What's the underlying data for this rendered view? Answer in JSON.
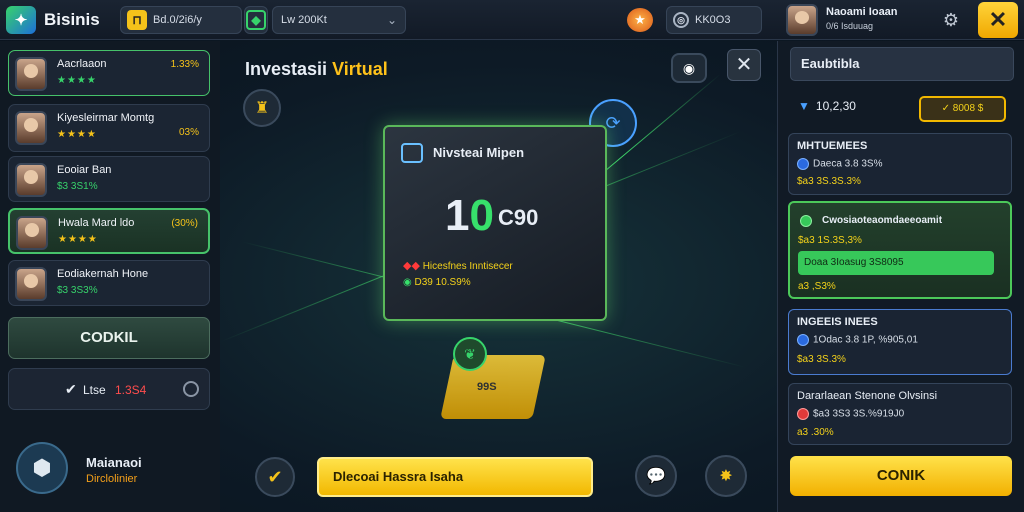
{
  "app": {
    "title": "Bisinis"
  },
  "topbar": {
    "coins": "Bd.0/2i6/y",
    "bet": "Lw 200Kt",
    "score": "KK0O3",
    "user_name": "Naoami Ioaan",
    "user_sub": "0/6 Isduuag"
  },
  "left": {
    "players": [
      {
        "name": "Aacrlaaon",
        "value": "1.33%",
        "sub": "★★★★"
      },
      {
        "name": "Kiyesleirmar Momtg",
        "value": "03%",
        "sub": "★★★★"
      },
      {
        "name": "Eooiar Ban",
        "value": "",
        "sub": "$3 3S1%"
      },
      {
        "name": "Hwala Mard ldo",
        "value": "(30%)",
        "sub": "★★★★"
      },
      {
        "name": "Eodiakernah Hone",
        "value": "",
        "sub": "$3 3S3%"
      }
    ],
    "action_button": "CODKIL",
    "likes_label": "Ltse",
    "likes_value": "1.3S4",
    "profile_name": "Maianaoi",
    "profile_sub": "Dirclolinier"
  },
  "center": {
    "title_main": "Investasii",
    "title_accent": "Virtual",
    "panel_title": "Nivsteai Mipen",
    "amount_main": "1",
    "amount_accent": "0",
    "amount_suffix": "C90",
    "row1": "Hicesfnes Inntisecer",
    "row2": "D39 10.S9%",
    "chip_text": "99S",
    "action_bar": "Dlecoai Hassra Isaha"
  },
  "right": {
    "title": "Eaubtibla",
    "balance": "10,2,30",
    "pay_label": "8008",
    "sections": [
      {
        "head": "MHTUEMEES",
        "line1": "Daeca 3.8 3S%",
        "line2": "$a3 3S.3S.3%"
      },
      {
        "head": "Cwosiaoteaomdaeeoamit",
        "line1": "$a3 1S.3S,3%",
        "line2": "Doaa 3Ioasug 3S8095",
        "line3": "a3 ,S3%"
      },
      {
        "head": "INGEEIS INEES",
        "line1": "1Odac 3.8 1P, %905,01",
        "line2": "$a3 3S.3%"
      },
      {
        "head": "Dararlaean Stenone Olvsinsi",
        "line1": "$a3 3S3 3S.%919J0",
        "line2": "a3 .30%"
      }
    ],
    "confirm_button": "CONIK"
  },
  "colors": {
    "accent_yellow": "#f2b800",
    "accent_green": "#37d36b",
    "accent_blue": "#2a6ae0"
  }
}
